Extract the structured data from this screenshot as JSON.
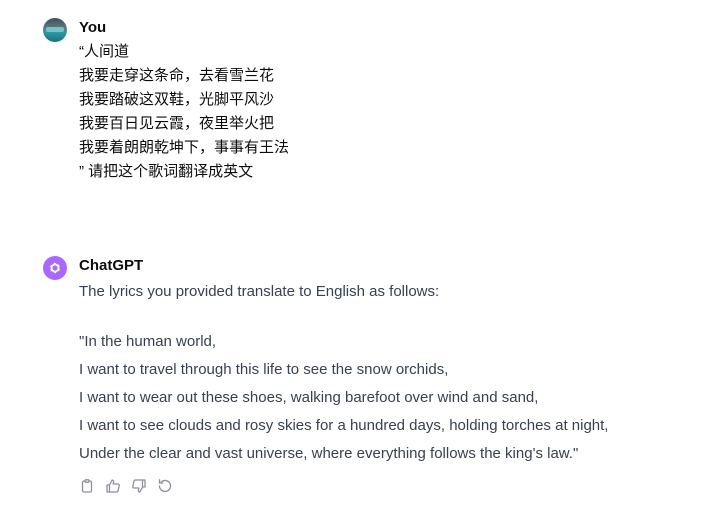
{
  "user_message": {
    "author": "You",
    "lines": [
      "“人间道",
      "我要走穿这条命，去看雪兰花",
      "我要踏破这双鞋，光脚平风沙",
      "我要百日见云霞，夜里举火把",
      "我要着朗朗乾坤下，事事有王法",
      "” 请把这个歌词翻译成英文"
    ]
  },
  "assistant_message": {
    "author": "ChatGPT",
    "intro": "The lyrics you provided translate to English as follows:",
    "lines": [
      "\"In the human world,",
      "I want to travel through this life to see the snow orchids,",
      "I want to wear out these shoes, walking barefoot over wind and sand,",
      "I want to see clouds and rosy skies for a hundred days, holding torches at night,",
      "Under the clear and vast universe, where everything follows the king's law.\""
    ]
  },
  "actions": {
    "icons": [
      "copy-icon",
      "thumbs-up-icon",
      "thumbs-down-icon",
      "regenerate-icon"
    ]
  },
  "colors": {
    "bot_avatar_bg": "#ab68ff",
    "text": "#0d0d0d",
    "assistant_text": "#374151",
    "icon": "#8e8ea0"
  }
}
